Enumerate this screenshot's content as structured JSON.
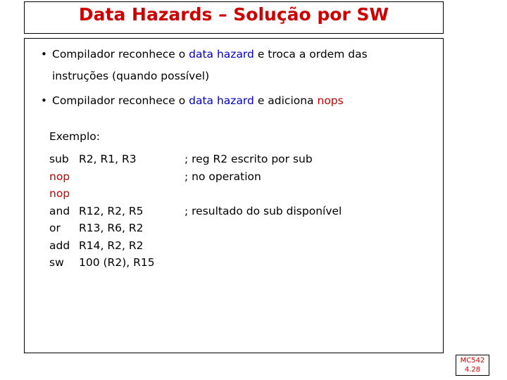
{
  "slide": {
    "title": "Data Hazards – Solução por SW",
    "bullets": [
      {
        "marker": "•",
        "segments": [
          {
            "text": "Compilador reconhece o ",
            "color": "black"
          },
          {
            "text": "data hazard",
            "color": "blue"
          },
          {
            "text": " e troca a ordem das",
            "color": "black"
          }
        ],
        "line2": "instruções (quando possível)"
      },
      {
        "marker": "•",
        "segments": [
          {
            "text": "Compilador reconhece o ",
            "color": "black"
          },
          {
            "text": "data hazard",
            "color": "blue"
          },
          {
            "text": " e adiciona ",
            "color": "black"
          },
          {
            "text": "nops",
            "color": "red"
          }
        ],
        "line2": ""
      }
    ],
    "example_label": "Exemplo:",
    "code": [
      {
        "op": "sub",
        "op_color": "black",
        "args": "R2, R1, R3",
        "comment": "; reg R2 escrito por sub"
      },
      {
        "op": "nop",
        "op_color": "red",
        "args": "",
        "comment": "; no operation"
      },
      {
        "op": "nop",
        "op_color": "red",
        "args": "",
        "comment": ""
      },
      {
        "op": "and",
        "op_color": "black",
        "args": "R12, R2, R5",
        "comment": "; resultado do sub disponível"
      },
      {
        "op": "or",
        "op_color": "black",
        "args": "R13, R6, R2",
        "comment": ""
      },
      {
        "op": "add",
        "op_color": "black",
        "args": "R14, R2, R2",
        "comment": ""
      },
      {
        "op": "sw",
        "op_color": "black",
        "args": "100 (R2), R15",
        "comment": ""
      }
    ],
    "footer": {
      "course": "MC542",
      "page": "4.28"
    },
    "colors": {
      "title": "#cc0000",
      "highlight_blue": "#0000cc",
      "highlight_red": "#cc0000",
      "text": "#000000"
    }
  }
}
